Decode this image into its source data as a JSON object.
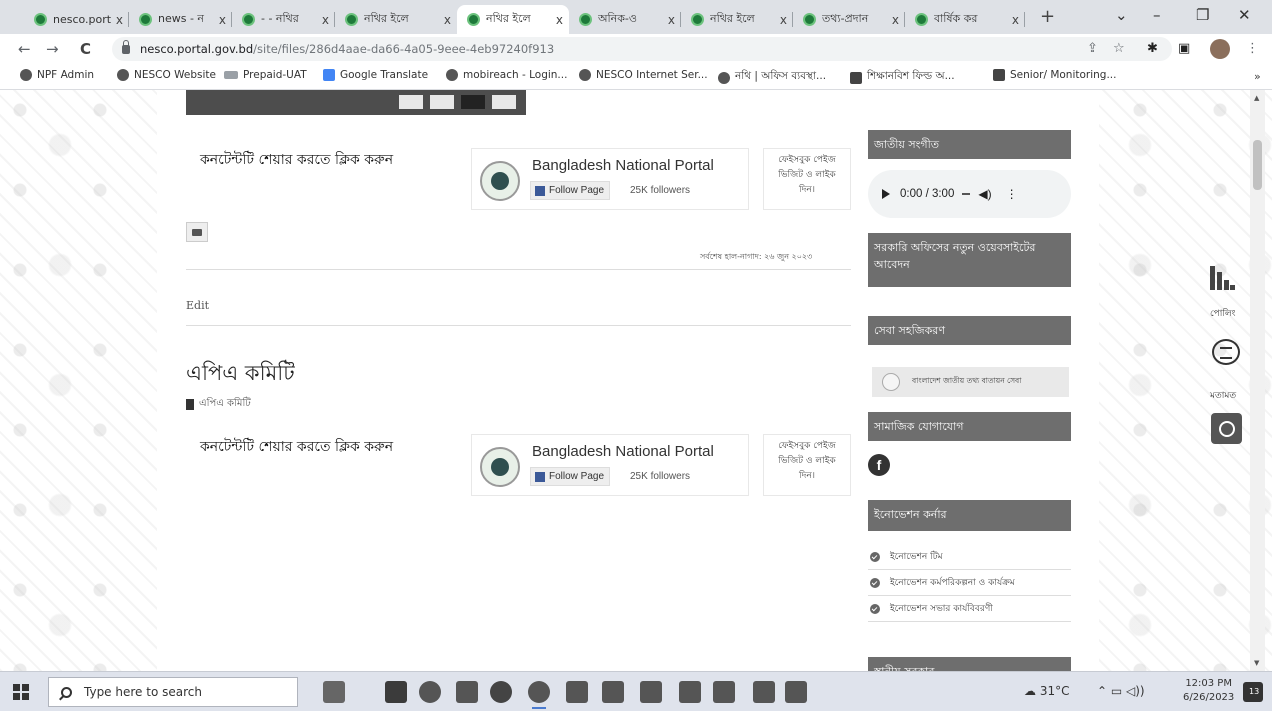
{
  "tabs": [
    {
      "label": "nesco.port",
      "active": false
    },
    {
      "label": "news - ন",
      "active": false
    },
    {
      "label": "- - নথির",
      "active": false
    },
    {
      "label": "নথির ইলে",
      "active": false
    },
    {
      "label": "নথির ইলে",
      "active": true
    },
    {
      "label": "অনিক-ও",
      "active": false
    },
    {
      "label": "নথির ইলে",
      "active": false
    },
    {
      "label": "তথ্য-প্রদান",
      "active": false
    },
    {
      "label": "বার্ষিক কর",
      "active": false
    }
  ],
  "tab_close_glyph": "x",
  "new_tab_glyph": "+",
  "window_controls": {
    "dropdown": "⌄",
    "minimize": "–",
    "restore": "❐",
    "close": "✕"
  },
  "nav": {
    "back": "←",
    "forward": "→",
    "reload": "C"
  },
  "url": {
    "host": "nesco.portal.gov.bd",
    "path": "/site/files/286d4aae-da66-4a05-9eee-4eb97240f913"
  },
  "bookmarks": [
    {
      "label": "NPF Admin",
      "icon": "site-icon"
    },
    {
      "label": "NESCO Website",
      "icon": "site-icon"
    },
    {
      "label": "Prepaid-UAT",
      "icon": "prepaid-icon"
    },
    {
      "label": "Google Translate",
      "icon": "google-translate-icon"
    },
    {
      "label": "mobireach - Login...",
      "icon": "globe-icon"
    },
    {
      "label": "NESCO Internet Ser...",
      "icon": "globe-icon"
    },
    {
      "label": "নথি | অফিস ব্যবস্থা...",
      "icon": "site-icon"
    },
    {
      "label": "শিক্ষানবিশ ফিল্ড অ...",
      "icon": "doc-icon"
    },
    {
      "label": "Senior/ Monitoring...",
      "icon": "doc-icon"
    }
  ],
  "bookmarks_more": "»",
  "main": {
    "share_text": "কনটেন্টটি শেয়ার করতে ক্লিক করুন",
    "fb_page_title": "Bangladesh National Portal",
    "fb_follow": "Follow Page",
    "fb_followers": "25K followers",
    "fb_note": [
      "ফেইসবুক পেইজ",
      "ভিজিট ও লাইক",
      "দিন।"
    ],
    "last_update": "সর্বশেষ হাল-নাগাদ: ২৬ জুন ২০২৩",
    "edit": "Edit",
    "section_title": "এপিএ কমিটি",
    "file_link": "এপিএ কমিটি"
  },
  "sidebar": {
    "national_anthem": "জাতীয় সংগীত",
    "audio_time": "0:00 / 3:00",
    "new_website": "সরকারি অফিসের নতুন ওয়েবসাইটের আবেদন",
    "service_simplification": "সেবা সহজিকরণ",
    "service_banner": "বাংলাদেশ জাতীয় তথ্য বাতায়ন সেবা",
    "social_media": "সামাজিক যোগাযোগ",
    "innovation_corner": "ইনোভেশন কর্নার",
    "innovation_items": [
      "ইনোভেশন টিম",
      "ইনোভেশন কর্মপরিকল্পনা ও কার্যক্রম",
      "ইনোভেশন সভার কার্যবিবরণী"
    ],
    "local_govt": "স্থানীয় সরকার"
  },
  "float_widgets": {
    "poll": "পোলিং",
    "feedback": "মতামত"
  },
  "taskbar": {
    "search_placeholder": "Type here to search",
    "weather": "31°C",
    "time": "12:03 PM",
    "date": "6/26/2023",
    "notif_count": "13"
  }
}
